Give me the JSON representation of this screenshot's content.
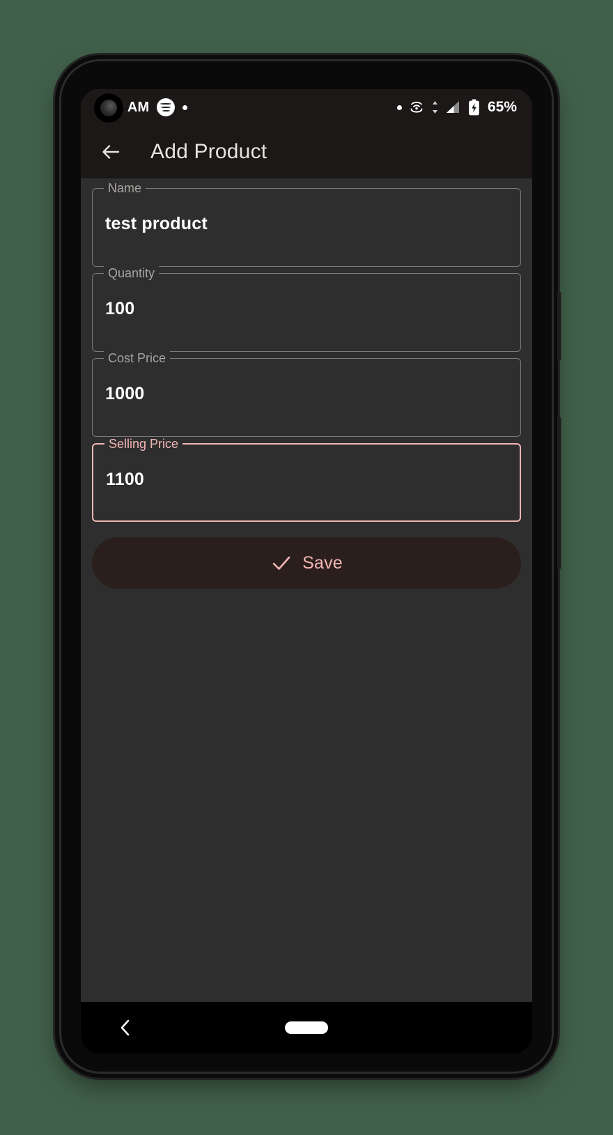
{
  "status_bar": {
    "time": ") AM",
    "spotify_icon": "spotify-icon",
    "notification_dot": "dot-icon",
    "right_dot": "dot-icon",
    "wifi_calling_icon": "wifi-calling-icon",
    "data_transfer_icon": "up-down-arrows-icon",
    "signal_icon": "signal-bars-icon",
    "battery_icon": "battery-charging-icon",
    "battery_percent": "65%"
  },
  "app_bar": {
    "back_icon": "back-arrow-icon",
    "title": "Add Product"
  },
  "form": {
    "fields": [
      {
        "label": "Name",
        "value": "test product",
        "focused": false
      },
      {
        "label": "Quantity",
        "value": "100",
        "focused": false
      },
      {
        "label": "Cost Price",
        "value": "1000",
        "focused": false
      },
      {
        "label": "Selling Price",
        "value": "1100",
        "focused": true
      }
    ]
  },
  "save_button": {
    "icon": "check-icon",
    "label": "Save"
  },
  "nav_bar": {
    "back_icon": "chevron-left-icon",
    "home_indicator": "home-pill-indicator"
  },
  "colors": {
    "accent": "#F3B7B3",
    "app_bar_bg": "#1B1817",
    "content_bg": "#2E2E2E",
    "save_bg": "#2B1F1E",
    "field_border": "#7D7A79",
    "label_text": "#A8A3A1",
    "page_bg": "#41604A"
  }
}
